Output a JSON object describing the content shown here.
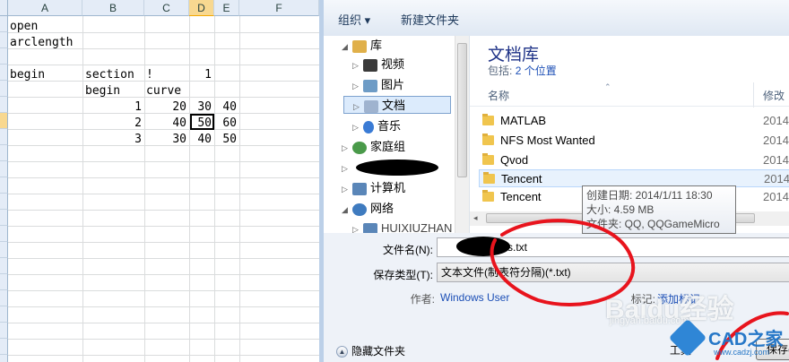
{
  "sheet": {
    "columns": [
      "A",
      "B",
      "C",
      "D",
      "E",
      "F"
    ],
    "cells": {
      "a1": "open",
      "a2": "arclength",
      "a4": "begin",
      "b4": "section",
      "c4": "!",
      "d4": "1",
      "b5": "begin",
      "c5": "curve",
      "b6": "1",
      "c6": "20",
      "d6": "30",
      "e6": "40",
      "b7": "2",
      "c7": "40",
      "d7": "50",
      "e7": "60",
      "b8": "3",
      "c8": "30",
      "d8": "40",
      "e8": "50"
    }
  },
  "dialog": {
    "toolbar": {
      "organize": "组织 ▾",
      "new_folder": "新建文件夹"
    },
    "tree": [
      {
        "label": "库",
        "icon": "library-icon",
        "color": "#e0b04a"
      },
      {
        "label": "视频",
        "icon": "video-icon",
        "color": "#3a3a3a"
      },
      {
        "label": "图片",
        "icon": "pictures-icon",
        "color": "#6e9cc6"
      },
      {
        "label": "文档",
        "icon": "documents-icon",
        "color": "#9fb3cf"
      },
      {
        "label": "音乐",
        "icon": "music-icon",
        "color": "#3a7bd5"
      },
      {
        "label": "家庭组",
        "icon": "homegroup-icon",
        "color": "#4a9a4a"
      },
      {
        "label": "计算机",
        "icon": "computer-icon",
        "color": "#5a86b8"
      },
      {
        "label": "网络",
        "icon": "network-icon",
        "color": "#3f7bbf"
      },
      {
        "label": "HUIXIUZHAN",
        "icon": "network-pc-icon",
        "color": "#5a86b8"
      }
    ],
    "library": {
      "title": "文档库",
      "includes_label": "包括:",
      "includes_link": "2 个位置",
      "col_name": "名称",
      "col_modified": "修改"
    },
    "files": [
      {
        "name": "MATLAB",
        "date": "2014"
      },
      {
        "name": "NFS Most Wanted",
        "date": "2014"
      },
      {
        "name": "Qvod",
        "date": "2014"
      },
      {
        "name": "Tencent",
        "date": "2014"
      },
      {
        "name": "Tencent",
        "date": "2014"
      }
    ],
    "tooltip": {
      "created": "创建日期: 2014/1/11 18:30",
      "size": "大小: 4.59 MB",
      "folders": "文件夹: QQ, QQGameMicro"
    },
    "filename_label": "文件名(N):",
    "filename_value": "s.txt",
    "filetype_label": "保存类型(T):",
    "filetype_value": "文本文件(制表符分隔)(*.txt)",
    "author_label": "作者:",
    "author_value": "Windows User",
    "tags_label": "标记:",
    "tags_value": "添加标记",
    "hide_folders": "隐藏文件夹",
    "tools_label": "工具",
    "save_label": "保存(S)"
  },
  "watermarks": {
    "baidu": "Baidu经验",
    "baidu_url": "jingyan.baidu.com",
    "cad": "CAD之家",
    "cad_url": "www.cadzj.com"
  }
}
